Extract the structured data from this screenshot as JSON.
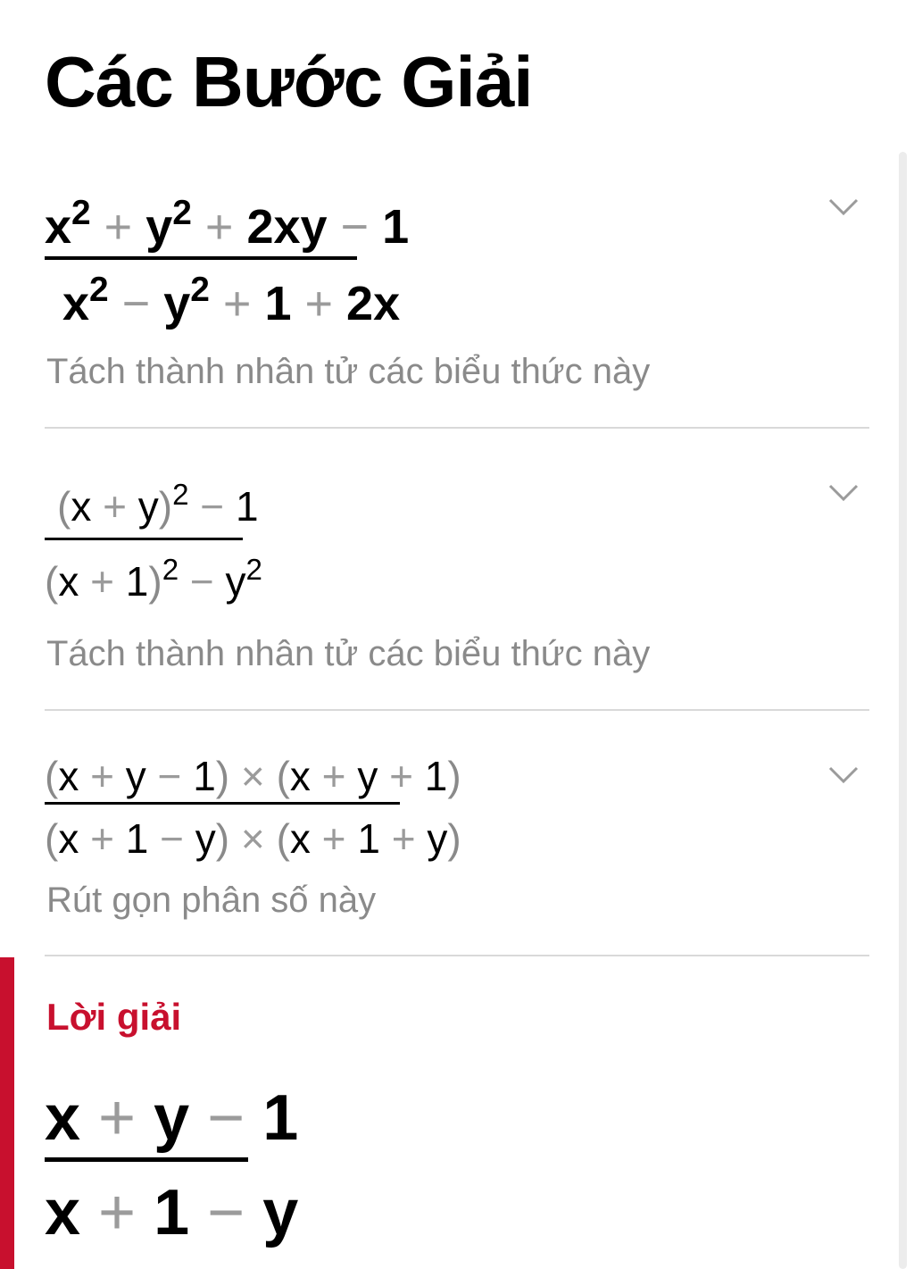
{
  "page_title": "Các Bước Giải",
  "steps": [
    {
      "description": "Tách thành nhân tử các biểu thức này"
    },
    {
      "description": "Tách thành nhân tử các biểu thức này"
    },
    {
      "description": "Rút gọn phân số này"
    }
  ],
  "solution": {
    "label": "Lời giải"
  },
  "icons": {
    "expand": "chevron-down-icon"
  },
  "colors": {
    "accent": "#c8102e",
    "operator": "#9b9b9b",
    "description": "#8a8a8a"
  }
}
